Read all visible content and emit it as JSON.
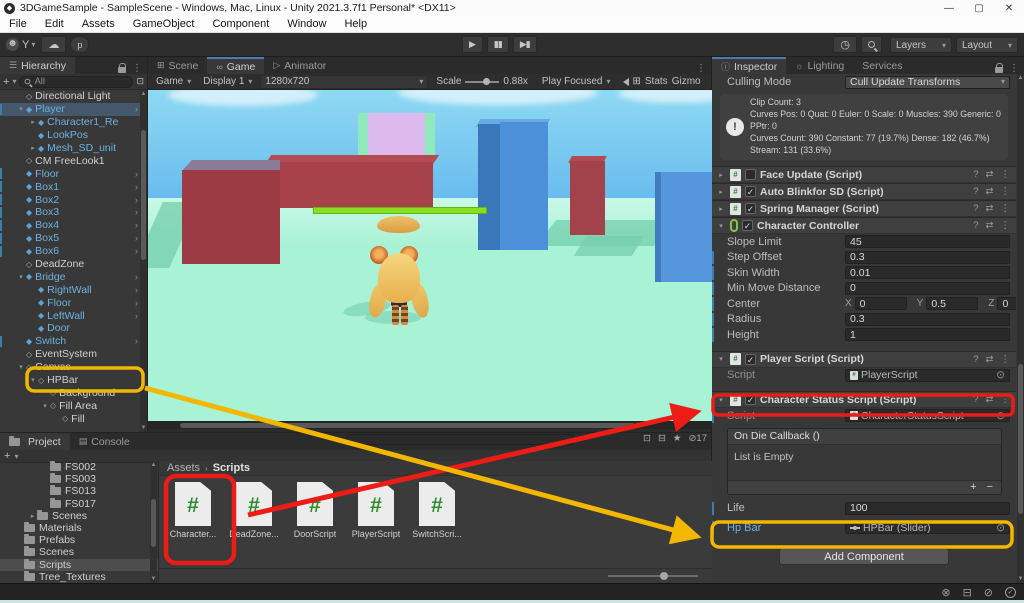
{
  "colors": {
    "annotation_red": "#ed1c16",
    "annotation_yellow": "#f3b700",
    "hp_green": "#86e01e",
    "accent_blue": "#4c7baf",
    "prefab_blue": "#6eb1e0"
  },
  "icons": {
    "hamburger": "☰",
    "kebab": "⋮",
    "plus": "+",
    "dropdown": "▾",
    "collapsed": "▸",
    "expanded": "▾",
    "play": "▶",
    "pause": "▮▮",
    "step": "▶▮",
    "history": "◷",
    "cloud": "☁",
    "avatar": "☻",
    "vcs": "p",
    "scene_tab": "⊞",
    "game_tab": "∞",
    "animator_tab": "▷",
    "inspector_tab": "ⓘ",
    "lighting_tab": "☼",
    "console_tab": "▤",
    "prefab_arrow": "›",
    "cube_prefab": "◆",
    "cube_plain": "◇",
    "help": "?",
    "presets": "⇄",
    "check": "✓",
    "target": "⊙",
    "star": "★",
    "package": "⊟",
    "search_in": "⊡",
    "hidden_eye": "⊘",
    "monitor": "⊞",
    "minimize": "—",
    "maximize": "▢",
    "close": "✕",
    "scroll_up": "▲",
    "scroll_down": "▼",
    "crumb_sep": "›",
    "notif_muted": "⊗",
    "cache": "⊟"
  },
  "title_bar": {
    "title": "3DGameSample - SampleScene - Windows, Mac, Linux - Unity 2021.3.7f1 Personal* <DX11>",
    "logo": "◆"
  },
  "menu": {
    "items": [
      "File",
      "Edit",
      "Assets",
      "GameObject",
      "Component",
      "Window",
      "Help"
    ]
  },
  "toolbar": {
    "account": "Y",
    "layers": "Layers",
    "layout": "Layout"
  },
  "center_tabs": [
    {
      "icon": "⊞",
      "label": "Scene",
      "active": false
    },
    {
      "icon": "∞",
      "label": "Game",
      "active": true
    },
    {
      "icon": "▷",
      "label": "Animator",
      "active": false
    }
  ],
  "game_bar": {
    "view": "Game",
    "display": "Display 1",
    "resolution": "1280x720",
    "scale_label": "Scale",
    "scale_value": "0.88x",
    "play_focused": "Play Focused",
    "stats": "Stats",
    "gizmos": "Gizmo"
  },
  "hierarchy": {
    "title": "Hierarchy",
    "search": "All",
    "items": [
      {
        "label": "Directional Light",
        "indent": 1,
        "style": "plain"
      },
      {
        "label": "Player",
        "indent": 1,
        "style": "prefab",
        "selected": true,
        "exp": "open",
        "arrow": true,
        "bar": true
      },
      {
        "label": "Character1_Re",
        "indent": 2,
        "style": "prefab",
        "exp": "closed"
      },
      {
        "label": "LookPos",
        "indent": 2,
        "style": "prefab"
      },
      {
        "label": "Mesh_SD_unit",
        "indent": 2,
        "style": "prefab",
        "exp": "closed"
      },
      {
        "label": "CM FreeLook1",
        "indent": 1,
        "style": "plain"
      },
      {
        "label": "Floor",
        "indent": 1,
        "style": "prefab",
        "arrow": true,
        "bar": true
      },
      {
        "label": "Box1",
        "indent": 1,
        "style": "prefab",
        "arrow": true,
        "bar": true
      },
      {
        "label": "Box2",
        "indent": 1,
        "style": "prefab",
        "arrow": true,
        "bar": true
      },
      {
        "label": "Box3",
        "indent": 1,
        "style": "prefab",
        "arrow": true,
        "bar": true
      },
      {
        "label": "Box4",
        "indent": 1,
        "style": "prefab",
        "arrow": true,
        "bar": true
      },
      {
        "label": "Box5",
        "indent": 1,
        "style": "prefab",
        "arrow": true,
        "bar": true
      },
      {
        "label": "Box6",
        "indent": 1,
        "style": "prefab",
        "arrow": true,
        "bar": true
      },
      {
        "label": "DeadZone",
        "indent": 1,
        "style": "plain"
      },
      {
        "label": "Bridge",
        "indent": 1,
        "style": "prefab",
        "exp": "open",
        "arrow": true
      },
      {
        "label": "RightWall",
        "indent": 2,
        "style": "prefab",
        "arrow": true
      },
      {
        "label": "Floor",
        "indent": 2,
        "style": "prefab",
        "arrow": true
      },
      {
        "label": "LeftWall",
        "indent": 2,
        "style": "prefab",
        "arrow": true
      },
      {
        "label": "Door",
        "indent": 2,
        "style": "prefab"
      },
      {
        "label": "Switch",
        "indent": 1,
        "style": "prefab",
        "arrow": true,
        "bar": true
      },
      {
        "label": "EventSystem",
        "indent": 1,
        "style": "plain"
      },
      {
        "label": "Canvas",
        "indent": 1,
        "style": "plain",
        "exp": "open"
      },
      {
        "label": "HPBar",
        "indent": 2,
        "style": "plain",
        "exp": "open"
      },
      {
        "label": "Background",
        "indent": 3,
        "style": "plain"
      },
      {
        "label": "Fill Area",
        "indent": 3,
        "style": "plain",
        "exp": "open"
      },
      {
        "label": "Fill",
        "indent": 4,
        "style": "plain"
      }
    ]
  },
  "inspector": {
    "tabs": [
      {
        "icon": "ⓘ",
        "label": "Inspector",
        "active": true
      },
      {
        "icon": "☼",
        "label": "Lighting",
        "active": false
      },
      {
        "icon": "",
        "label": "Services",
        "active": false
      }
    ],
    "culling_label": "Culling Mode",
    "culling_value": "Cull Update Transforms",
    "info_lines": [
      "Clip Count: 3",
      "Curves Pos: 0 Quat: 0 Euler: 0 Scale: 0 Muscles: 390 Generic: 0",
      "PPtr: 0",
      "Curves Count: 390 Constant: 77 (19.7%) Dense: 182 (46.7%)",
      "Stream: 131 (33.6%)"
    ],
    "components": [
      {
        "name": "Face Update (Script)",
        "checked": false,
        "icon": "script"
      },
      {
        "name": "Auto Blinkfor SD (Script)",
        "checked": true,
        "icon": "script"
      },
      {
        "name": "Spring Manager (Script)",
        "checked": true,
        "icon": "script"
      },
      {
        "name": "Character Controller",
        "checked": true,
        "icon": "capsule",
        "expanded": true
      }
    ],
    "cc_props": [
      {
        "label": "Slope Limit",
        "value": "45"
      },
      {
        "label": "Step Offset",
        "value": "0.3",
        "bar": true
      },
      {
        "label": "Skin Width",
        "value": "0.01",
        "bar": true
      },
      {
        "label": "Min Move Distance",
        "value": "0",
        "bar": true
      },
      {
        "label": "Center",
        "x": "0",
        "y": "0.5",
        "z": "0",
        "bar": true
      },
      {
        "label": "Radius",
        "value": "0.3",
        "bar": true
      },
      {
        "label": "Height",
        "value": "1",
        "bar": true
      }
    ],
    "player_script": {
      "title": "Player Script (Script)",
      "script_label": "Script",
      "script_value": "PlayerScript"
    },
    "char_status": {
      "title": "Character Status Script (Script)",
      "script_label": "Script",
      "script_value": "CharacterStatusScript",
      "callback": "On Die Callback ()",
      "empty": "List is Empty",
      "plus": "+",
      "minus": "−",
      "life_label": "Life",
      "life_value": "100",
      "hp_label": "Hp Bar",
      "hp_value": "HPBar (Slider)"
    },
    "add_component": "Add Component"
  },
  "project": {
    "tabs": [
      {
        "label": "Project",
        "active": true
      },
      {
        "label": "Console",
        "active": false
      }
    ],
    "folders": [
      {
        "label": "FS002",
        "indent": 3
      },
      {
        "label": "FS003",
        "indent": 3
      },
      {
        "label": "FS013",
        "indent": 3
      },
      {
        "label": "FS017",
        "indent": 3
      },
      {
        "label": "Scenes",
        "indent": 2,
        "exp": "closed"
      },
      {
        "label": "Materials",
        "indent": 1
      },
      {
        "label": "Prefabs",
        "indent": 1
      },
      {
        "label": "Scenes",
        "indent": 1
      },
      {
        "label": "Scripts",
        "indent": 1,
        "selected": true
      },
      {
        "label": "Tree_Textures",
        "indent": 1
      }
    ],
    "breadcrumb": {
      "root": "Assets",
      "current": "Scripts"
    },
    "scripts": [
      "Character...",
      "DeadZone...",
      "DoorScript",
      "PlayerScript",
      "SwitchScri..."
    ],
    "hidden_count": "17"
  }
}
